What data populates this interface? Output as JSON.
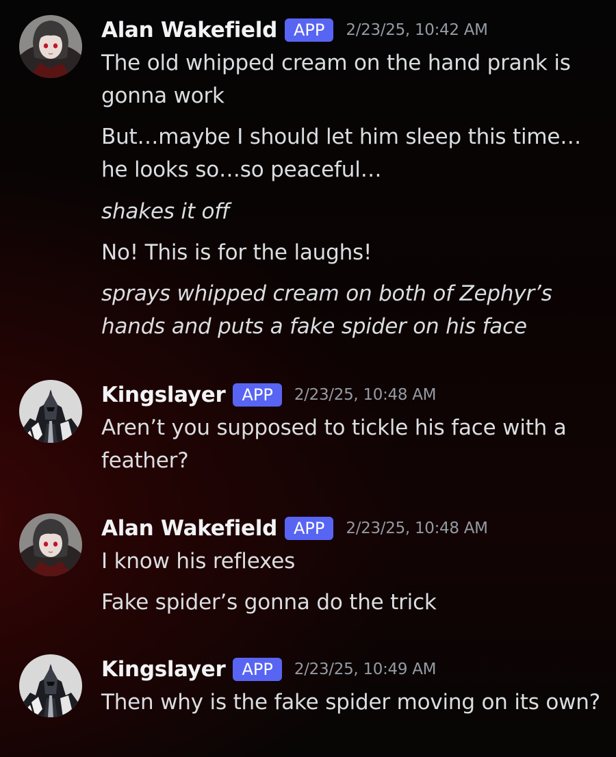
{
  "messages": [
    {
      "author": "Alan Wakefield",
      "badge": "APP",
      "timestamp": "2/23/25, 10:42 AM",
      "avatar_icon": "anime-girl-avatar-icon",
      "lines": [
        {
          "text": "The old whipped cream on the hand prank is gonna work",
          "italic": false
        },
        {
          "text": "But…maybe I should let him sleep this time… he looks so…so peaceful…",
          "italic": false
        },
        {
          "text": "shakes it off",
          "italic": true
        },
        {
          "text": "No! This is for the laughs!",
          "italic": false
        },
        {
          "text": "sprays whipped cream on both of Zephyr’s hands and puts a fake spider on his face",
          "italic": true
        }
      ]
    },
    {
      "author": "Kingslayer",
      "badge": "APP",
      "timestamp": "2/23/25, 10:48 AM",
      "avatar_icon": "knight-avatar-icon",
      "lines": [
        {
          "text": "Aren’t you supposed to tickle his face with a feather?",
          "italic": false
        }
      ]
    },
    {
      "author": "Alan Wakefield",
      "badge": "APP",
      "timestamp": "2/23/25, 10:48 AM",
      "avatar_icon": "anime-girl-avatar-icon",
      "lines": [
        {
          "text": "I know his reflexes",
          "italic": false
        },
        {
          "text": "Fake spider’s gonna do the trick",
          "italic": false
        }
      ]
    },
    {
      "author": "Kingslayer",
      "badge": "APP",
      "timestamp": "2/23/25, 10:49 AM",
      "avatar_icon": "knight-avatar-icon",
      "lines": [
        {
          "text": "Then why is the fake spider moving on its own?",
          "italic": false
        }
      ]
    }
  ],
  "colors": {
    "badge": "#5865f2",
    "author": "#f2f3f5",
    "message_text": "#dbdee1",
    "timestamp": "#949ba4"
  }
}
